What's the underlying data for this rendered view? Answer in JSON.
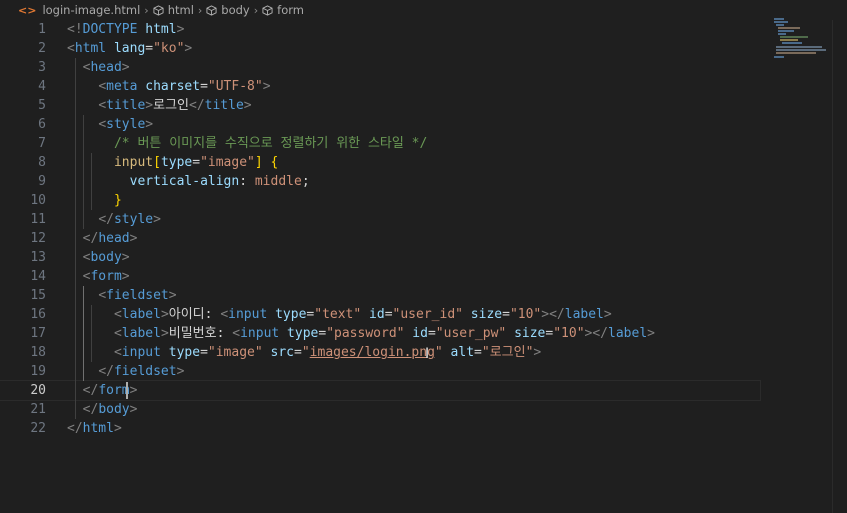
{
  "breadcrumb": {
    "file": "login-image.html",
    "items": [
      "html",
      "body",
      "form"
    ]
  },
  "editor": {
    "active_line": "20",
    "lines": [
      {
        "n": "1",
        "tokens": [
          [
            "br",
            "<!"
          ],
          [
            "tag",
            "DOCTYPE"
          ],
          [
            "attr",
            " html"
          ],
          [
            "br",
            ">"
          ]
        ]
      },
      {
        "n": "2",
        "tokens": [
          [
            "br",
            "<"
          ],
          [
            "tag",
            "html"
          ],
          [
            "attr",
            " lang"
          ],
          [
            "punc",
            "="
          ],
          [
            "str",
            "\"ko\""
          ],
          [
            "br",
            ">"
          ]
        ]
      },
      {
        "n": "3",
        "tokens": [
          [
            "txt",
            "  "
          ],
          [
            "br",
            "<"
          ],
          [
            "tag",
            "head"
          ],
          [
            "br",
            ">"
          ]
        ]
      },
      {
        "n": "4",
        "tokens": [
          [
            "txt",
            "    "
          ],
          [
            "br",
            "<"
          ],
          [
            "tag",
            "meta"
          ],
          [
            "attr",
            " charset"
          ],
          [
            "punc",
            "="
          ],
          [
            "str",
            "\"UTF-8\""
          ],
          [
            "br",
            ">"
          ]
        ]
      },
      {
        "n": "5",
        "tokens": [
          [
            "txt",
            "    "
          ],
          [
            "br",
            "<"
          ],
          [
            "tag",
            "title"
          ],
          [
            "br",
            ">"
          ],
          [
            "txt",
            "로그인"
          ],
          [
            "br",
            "</"
          ],
          [
            "tag",
            "title"
          ],
          [
            "br",
            ">"
          ]
        ]
      },
      {
        "n": "6",
        "tokens": [
          [
            "txt",
            "    "
          ],
          [
            "br",
            "<"
          ],
          [
            "tag",
            "style"
          ],
          [
            "br",
            ">"
          ]
        ]
      },
      {
        "n": "7",
        "tokens": [
          [
            "txt",
            "      "
          ],
          [
            "cmt",
            "/* 버튼 이미지를 수직으로 정렬하기 위한 스타일 */"
          ]
        ]
      },
      {
        "n": "8",
        "tokens": [
          [
            "txt",
            "      "
          ],
          [
            "sel",
            "input"
          ],
          [
            "brace",
            "["
          ],
          [
            "attr",
            "type"
          ],
          [
            "punc",
            "="
          ],
          [
            "str",
            "\"image\""
          ],
          [
            "brace",
            "]"
          ],
          [
            "punc",
            " "
          ],
          [
            "brace",
            "{"
          ]
        ]
      },
      {
        "n": "9",
        "tokens": [
          [
            "txt",
            "        "
          ],
          [
            "prop",
            "vertical-align"
          ],
          [
            "punc",
            ": "
          ],
          [
            "val",
            "middle"
          ],
          [
            "punc",
            ";"
          ]
        ]
      },
      {
        "n": "10",
        "tokens": [
          [
            "txt",
            "      "
          ],
          [
            "brace",
            "}"
          ]
        ]
      },
      {
        "n": "11",
        "tokens": [
          [
            "txt",
            "    "
          ],
          [
            "br",
            "</"
          ],
          [
            "tag",
            "style"
          ],
          [
            "br",
            ">"
          ]
        ]
      },
      {
        "n": "12",
        "tokens": [
          [
            "txt",
            "  "
          ],
          [
            "br",
            "</"
          ],
          [
            "tag",
            "head"
          ],
          [
            "br",
            ">"
          ]
        ]
      },
      {
        "n": "13",
        "tokens": [
          [
            "txt",
            "  "
          ],
          [
            "br",
            "<"
          ],
          [
            "tag",
            "body"
          ],
          [
            "br",
            ">"
          ]
        ]
      },
      {
        "n": "14",
        "tokens": [
          [
            "txt",
            "  "
          ],
          [
            "br",
            "<"
          ],
          [
            "tag",
            "form"
          ],
          [
            "br",
            ">"
          ]
        ]
      },
      {
        "n": "15",
        "tokens": [
          [
            "txt",
            "    "
          ],
          [
            "br",
            "<"
          ],
          [
            "tag",
            "fieldset"
          ],
          [
            "br",
            ">"
          ]
        ]
      },
      {
        "n": "16",
        "tokens": [
          [
            "txt",
            "      "
          ],
          [
            "br",
            "<"
          ],
          [
            "tag",
            "label"
          ],
          [
            "br",
            ">"
          ],
          [
            "txt",
            "아이디: "
          ],
          [
            "br",
            "<"
          ],
          [
            "tag",
            "input"
          ],
          [
            "attr",
            " type"
          ],
          [
            "punc",
            "="
          ],
          [
            "str",
            "\"text\""
          ],
          [
            "attr",
            " id"
          ],
          [
            "punc",
            "="
          ],
          [
            "str",
            "\"user_id\""
          ],
          [
            "attr",
            " size"
          ],
          [
            "punc",
            "="
          ],
          [
            "str",
            "\"10\""
          ],
          [
            "br",
            ">"
          ],
          [
            "br",
            "</"
          ],
          [
            "tag",
            "label"
          ],
          [
            "br",
            ">"
          ]
        ]
      },
      {
        "n": "17",
        "tokens": [
          [
            "txt",
            "      "
          ],
          [
            "br",
            "<"
          ],
          [
            "tag",
            "label"
          ],
          [
            "br",
            ">"
          ],
          [
            "txt",
            "비밀번호: "
          ],
          [
            "br",
            "<"
          ],
          [
            "tag",
            "input"
          ],
          [
            "attr",
            " type"
          ],
          [
            "punc",
            "="
          ],
          [
            "str",
            "\"password\""
          ],
          [
            "attr",
            " id"
          ],
          [
            "punc",
            "="
          ],
          [
            "str",
            "\"user_pw\""
          ],
          [
            "attr",
            " size"
          ],
          [
            "punc",
            "="
          ],
          [
            "str",
            "\"10\""
          ],
          [
            "br",
            ">"
          ],
          [
            "br",
            "</"
          ],
          [
            "tag",
            "label"
          ],
          [
            "br",
            ">"
          ]
        ]
      },
      {
        "n": "18",
        "tokens": [
          [
            "txt",
            "      "
          ],
          [
            "br",
            "<"
          ],
          [
            "tag",
            "input"
          ],
          [
            "attr",
            " type"
          ],
          [
            "punc",
            "="
          ],
          [
            "str",
            "\"image\""
          ],
          [
            "attr",
            " src"
          ],
          [
            "punc",
            "="
          ],
          [
            "str",
            "\""
          ],
          [
            "link",
            "images/login.png"
          ],
          [
            "str",
            "\""
          ],
          [
            "attr",
            " alt"
          ],
          [
            "punc",
            "="
          ],
          [
            "str",
            "\"로그인\""
          ],
          [
            "br",
            ">"
          ]
        ]
      },
      {
        "n": "19",
        "tokens": [
          [
            "txt",
            "    "
          ],
          [
            "br",
            "</"
          ],
          [
            "tag",
            "fieldset"
          ],
          [
            "br",
            ">"
          ]
        ]
      },
      {
        "n": "20",
        "tokens": [
          [
            "txt",
            "  "
          ],
          [
            "br",
            "</"
          ],
          [
            "tag",
            "form"
          ],
          [
            "br",
            ">"
          ]
        ]
      },
      {
        "n": "21",
        "tokens": [
          [
            "txt",
            "  "
          ],
          [
            "br",
            "</"
          ],
          [
            "tag",
            "body"
          ],
          [
            "br",
            ">"
          ]
        ]
      },
      {
        "n": "22",
        "tokens": [
          [
            "br",
            "</"
          ],
          [
            "tag",
            "html"
          ],
          [
            "br",
            ">"
          ]
        ]
      }
    ]
  },
  "icons": {
    "file_icon": "html-file-icon",
    "symbol_icon": "cube-icon",
    "separator": "chevron-right-icon"
  },
  "colors": {
    "background": "#1f1f1f",
    "tag": "#569cd6",
    "attribute": "#9cdcfe",
    "string": "#ce9178",
    "comment": "#6a9955",
    "bracket": "#808080"
  }
}
